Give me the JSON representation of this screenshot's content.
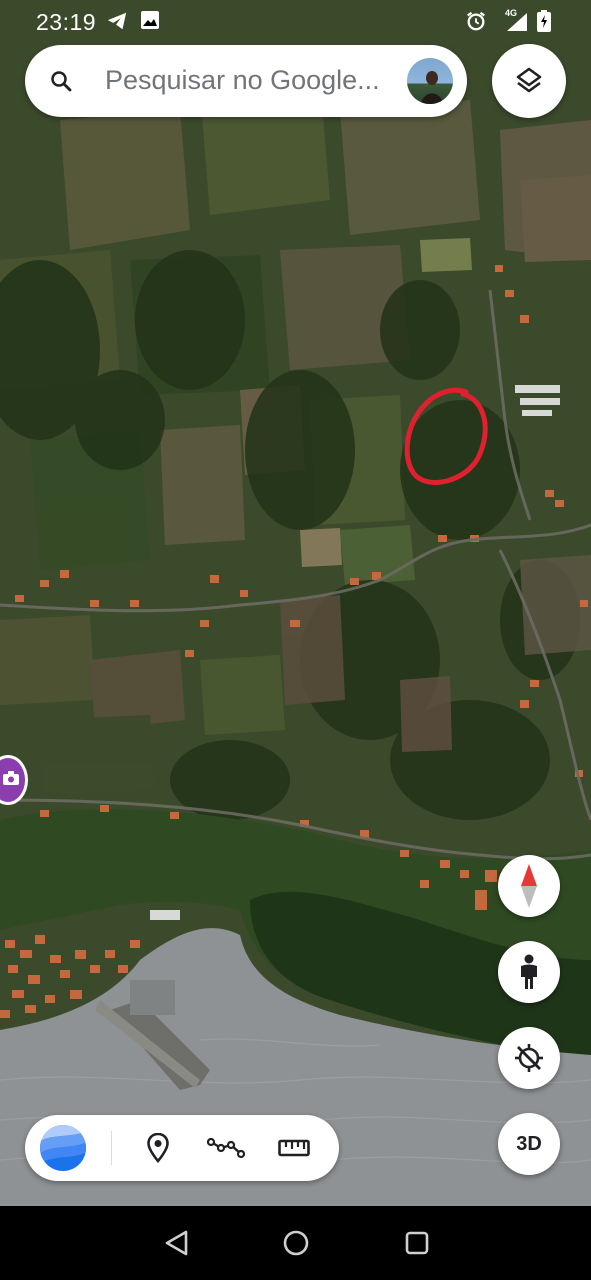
{
  "status_bar": {
    "time": "23:19",
    "network": "4G",
    "icons_left": [
      "telegram-icon",
      "gallery-icon"
    ],
    "icons_right": [
      "alarm-icon",
      "signal-icon",
      "battery-icon"
    ]
  },
  "search": {
    "placeholder": "Pesquisar no Google..."
  },
  "map": {
    "type": "satellite",
    "annotation": "red-circle",
    "colors": {
      "annotation": "#e0202e",
      "sea": "#8f9294"
    }
  },
  "controls": {
    "layers": "layers-icon",
    "compass": "compass-icon",
    "street_view": "pegman-icon",
    "location": "location-off-icon",
    "three_d_label": "3D"
  },
  "toolbar": {
    "items": [
      "google-earth-logo",
      "placemark-icon",
      "path-icon",
      "measure-icon"
    ]
  },
  "navbar": {
    "items": [
      "back-icon",
      "home-icon",
      "recents-icon"
    ]
  }
}
